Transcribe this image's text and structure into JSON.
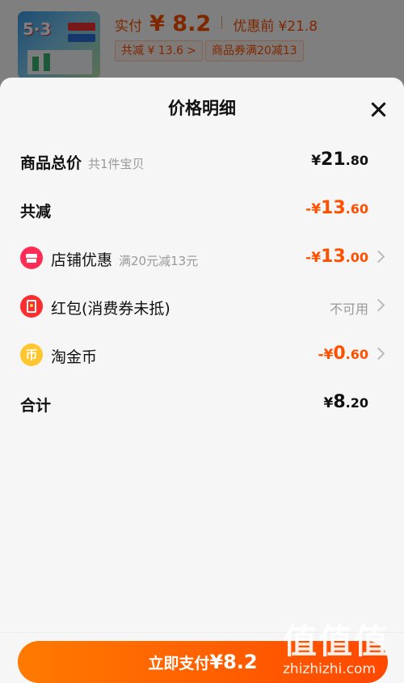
{
  "product": {
    "thumbnail_icon": "book-cover-icon",
    "thumbnail_text": "5·3",
    "paid_label": "实付",
    "paid_currency": "¥",
    "paid_amount": "8.2",
    "original_label": "优惠前",
    "original_price": "¥21.8",
    "chip_total_discount": "共减 ¥ 13.6 >",
    "chip_coupon": "商品券满20减13"
  },
  "sheet": {
    "title": "价格明细",
    "close_icon": "close-icon",
    "rows": [
      {
        "label": "商品总价",
        "sub": "共1件宝贝",
        "cur": "¥",
        "int": "21",
        "dec": ".80",
        "color": "#111111"
      },
      {
        "label": "共减",
        "sub": "",
        "cur": "-¥",
        "int": "13",
        "dec": ".60",
        "color": "#ff5000"
      },
      {
        "label": "店铺优惠",
        "sub": "满20元减13元",
        "cur": "-¥",
        "int": "13",
        "dec": ".00",
        "color": "#ff5000",
        "icon": "store-icon"
      },
      {
        "label": "红包(消费券未抵)",
        "sub": "",
        "status": "不可用",
        "icon": "red-packet-icon"
      },
      {
        "label": "淘金币",
        "sub": "",
        "cur": "-¥",
        "int": "0",
        "dec": ".60",
        "color": "#ff5000",
        "icon": "coin-icon"
      },
      {
        "label": "合计",
        "sub": "",
        "cur": "¥",
        "int": "8",
        "dec": ".20",
        "color": "#111111"
      }
    ]
  },
  "footer": {
    "pay_button_label": "立即支付",
    "pay_button_amount": "¥8.2"
  },
  "watermark": {
    "glyphs": "值值值",
    "url": "zhizhizhi.com"
  },
  "colors": {
    "accent": "#ff5000",
    "overlay": "rgba(0,0,0,0.5)"
  }
}
